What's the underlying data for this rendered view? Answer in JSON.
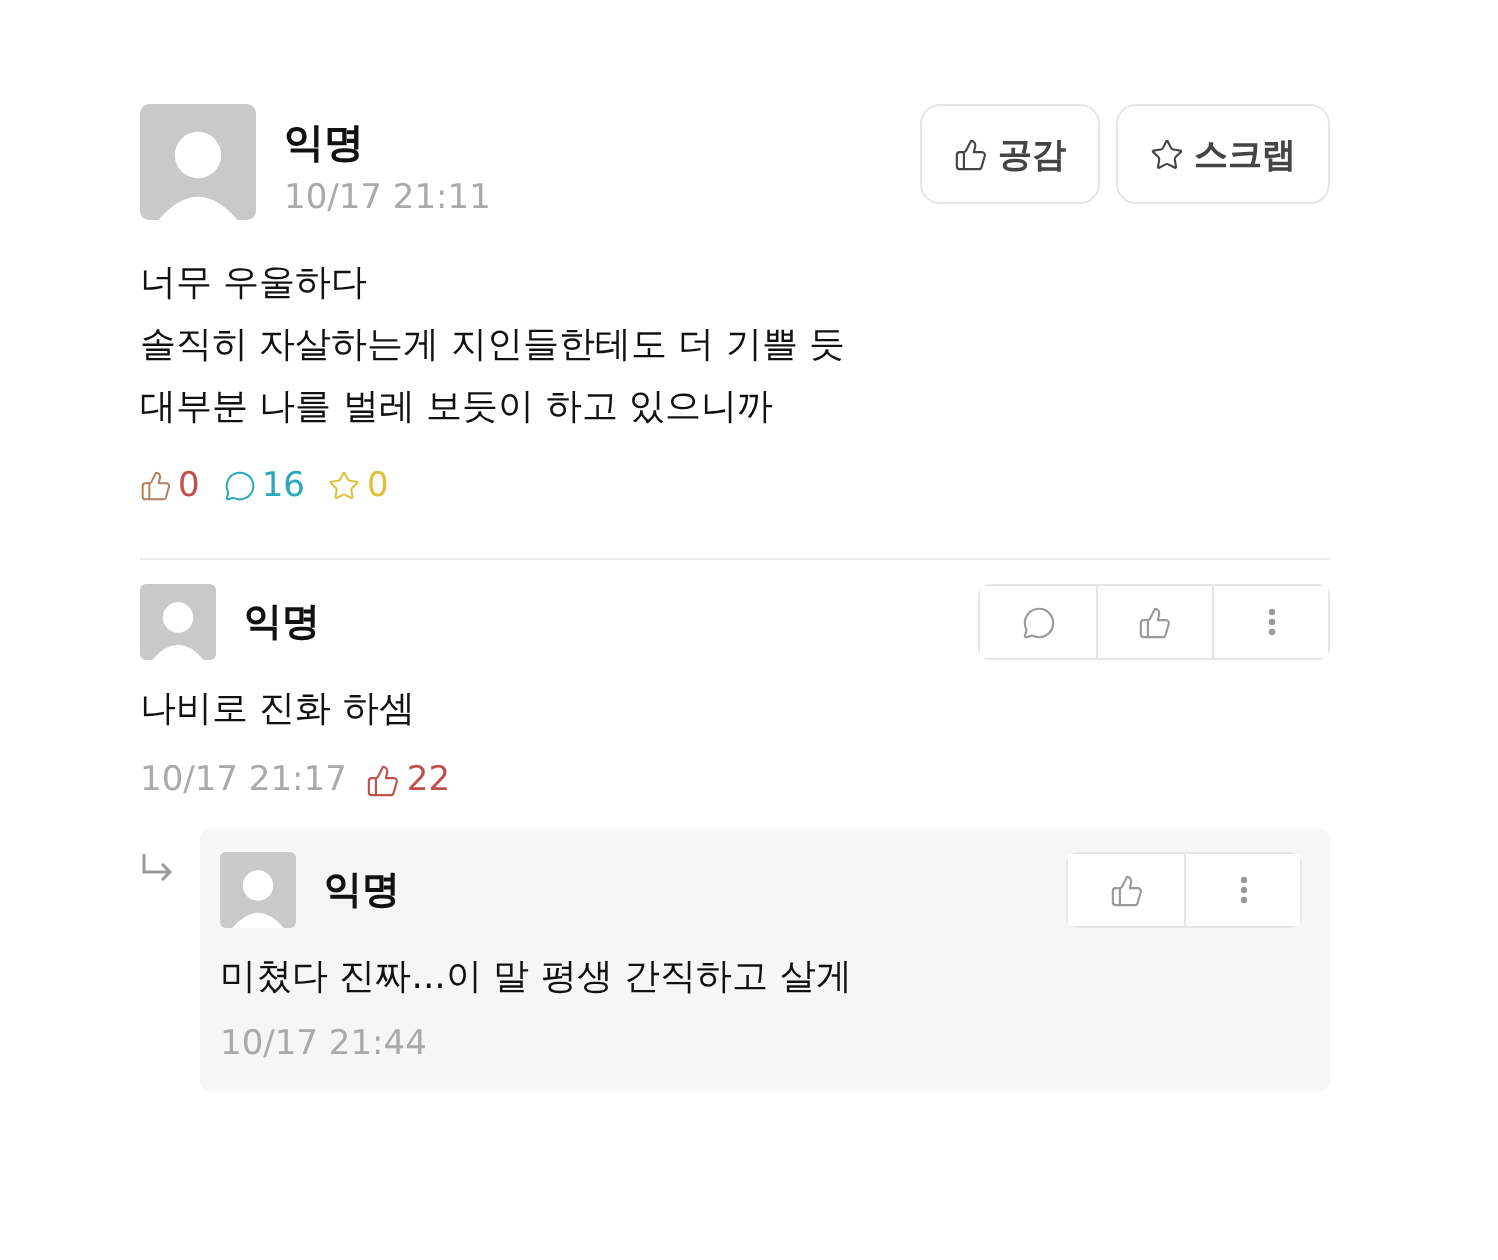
{
  "post": {
    "author": "익명",
    "time": "10/17 21:11",
    "actions": [
      {
        "kind": "like",
        "label": "공감"
      },
      {
        "kind": "scrap",
        "label": "스크랩"
      }
    ],
    "body": [
      "너무 우울하다",
      "솔직히 자살하는게 지인들한테도 더 기쁠 듯",
      "대부분 나를 벌레 보듯이 하고 있으니까"
    ],
    "counts": {
      "likes": "0",
      "comments": "16",
      "scraps": "0"
    }
  },
  "comments": [
    {
      "author": "익명",
      "text": "나비로 진화 하셈",
      "time": "10/17 21:17",
      "likes": "22",
      "actions": [
        {
          "kind": "reply"
        },
        {
          "kind": "like"
        },
        {
          "kind": "more"
        }
      ],
      "children": [
        {
          "author": "익명",
          "text": "미쳤다 진짜...이 말 평생 간직하고 살게",
          "time": "10/17 21:44",
          "actions": [
            {
              "kind": "like"
            },
            {
              "kind": "more"
            }
          ]
        }
      ]
    }
  ]
}
